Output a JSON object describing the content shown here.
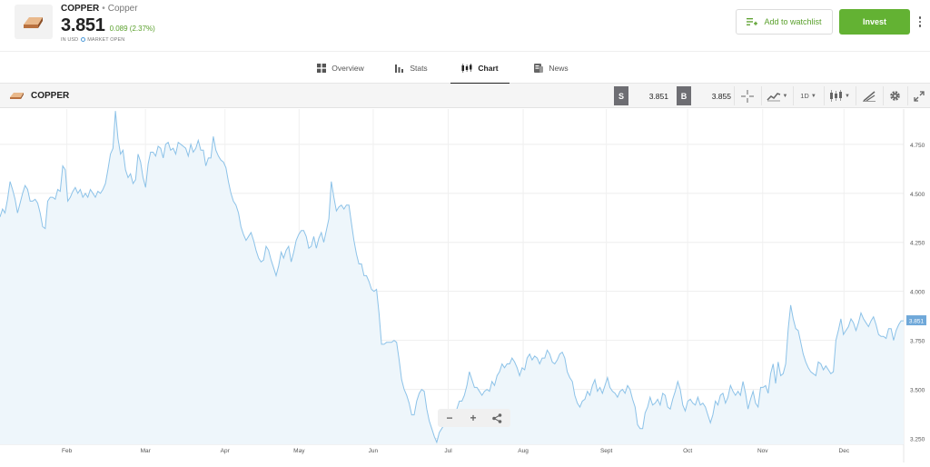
{
  "header": {
    "symbol": "COPPER",
    "separator": "•",
    "name": "Copper",
    "price": "3.851",
    "change": "0.089 (2.37%)",
    "currency_note": "IN USD",
    "market_status": "MARKET OPEN",
    "watchlist_label": "Add to watchlist",
    "invest_label": "Invest",
    "icons": {
      "logo": "copper-bar-icon",
      "watchlist": "add-to-list-icon",
      "more": "more-vertical-icon"
    }
  },
  "tabs": [
    {
      "label": "Overview",
      "icon": "grid-icon",
      "active": false
    },
    {
      "label": "Stats",
      "icon": "bar-chart-icon",
      "active": false
    },
    {
      "label": "Chart",
      "icon": "candles-icon",
      "active": true
    },
    {
      "label": "News",
      "icon": "news-icon",
      "active": false
    }
  ],
  "toolbar": {
    "symbol": "COPPER",
    "sell_label": "S",
    "sell_price": "3.851",
    "buy_label": "B",
    "buy_price": "3.855",
    "interval": "1D",
    "tools": [
      "crosshair-icon",
      "chart-type-icon",
      "interval-selector",
      "indicators-icon",
      "drawing-icon",
      "settings-icon",
      "fullscreen-icon"
    ]
  },
  "colors": {
    "accent_green": "#63b233",
    "change_green": "#5aa02c",
    "line_blue": "#8cc2e8",
    "area_fill": "#eef6fb",
    "badge_blue": "#6fa8d9"
  },
  "chart_data": {
    "type": "area",
    "x_labels": [
      "Feb",
      "Mar",
      "Apr",
      "May",
      "Jun",
      "Jul",
      "Aug",
      "Sept",
      "Oct",
      "Nov",
      "Dec"
    ],
    "y_ticks": [
      "4.750",
      "4.500",
      "4.250",
      "4.000",
      "3.750",
      "3.500",
      "3.250"
    ],
    "ylim": [
      3.22,
      4.93
    ],
    "last_value_label": "3.851",
    "grid": true,
    "values": [
      4.38,
      4.42,
      4.4,
      4.47,
      4.56,
      4.52,
      4.47,
      4.4,
      4.45,
      4.5,
      4.54,
      4.52,
      4.46,
      4.46,
      4.47,
      4.45,
      4.4,
      4.33,
      4.32,
      4.46,
      4.48,
      4.48,
      4.47,
      4.52,
      4.51,
      4.64,
      4.62,
      4.46,
      4.48,
      4.51,
      4.53,
      4.5,
      4.52,
      4.48,
      4.5,
      4.48,
      4.52,
      4.5,
      4.48,
      4.51,
      4.5,
      4.52,
      4.55,
      4.62,
      4.7,
      4.73,
      4.92,
      4.78,
      4.7,
      4.72,
      4.62,
      4.58,
      4.6,
      4.55,
      4.57,
      4.7,
      4.66,
      4.58,
      4.53,
      4.65,
      4.71,
      4.71,
      4.69,
      4.74,
      4.73,
      4.68,
      4.75,
      4.76,
      4.72,
      4.73,
      4.7,
      4.76,
      4.75,
      4.74,
      4.73,
      4.69,
      4.75,
      4.71,
      4.73,
      4.77,
      4.72,
      4.72,
      4.64,
      4.68,
      4.68,
      4.79,
      4.72,
      4.69,
      4.67,
      4.66,
      4.63,
      4.56,
      4.5,
      4.46,
      4.44,
      4.4,
      4.33,
      4.29,
      4.26,
      4.28,
      4.3,
      4.26,
      4.21,
      4.17,
      4.15,
      4.16,
      4.23,
      4.21,
      4.16,
      4.12,
      4.08,
      4.13,
      4.2,
      4.17,
      4.21,
      4.23,
      4.15,
      4.2,
      4.26,
      4.29,
      4.31,
      4.31,
      4.28,
      4.22,
      4.23,
      4.28,
      4.22,
      4.27,
      4.3,
      4.25,
      4.31,
      4.37,
      4.56,
      4.48,
      4.41,
      4.43,
      4.44,
      4.42,
      4.44,
      4.44,
      4.35,
      4.26,
      4.19,
      4.14,
      4.14,
      4.08,
      4.08,
      4.05,
      4.01,
      4.0,
      4.01,
      3.89,
      3.73,
      3.73,
      3.74,
      3.74,
      3.74,
      3.75,
      3.74,
      3.65,
      3.55,
      3.5,
      3.47,
      3.43,
      3.37,
      3.37,
      3.44,
      3.48,
      3.5,
      3.49,
      3.4,
      3.34,
      3.3,
      3.26,
      3.23,
      3.28,
      3.3,
      3.32,
      3.32,
      3.33,
      3.33,
      3.36,
      3.4,
      3.44,
      3.44,
      3.47,
      3.52,
      3.59,
      3.55,
      3.51,
      3.51,
      3.49,
      3.47,
      3.49,
      3.5,
      3.49,
      3.54,
      3.52,
      3.57,
      3.59,
      3.63,
      3.61,
      3.63,
      3.63,
      3.66,
      3.64,
      3.61,
      3.57,
      3.61,
      3.6,
      3.66,
      3.68,
      3.65,
      3.67,
      3.66,
      3.63,
      3.66,
      3.66,
      3.7,
      3.68,
      3.64,
      3.63,
      3.65,
      3.68,
      3.69,
      3.66,
      3.59,
      3.56,
      3.54,
      3.47,
      3.43,
      3.41,
      3.44,
      3.45,
      3.49,
      3.47,
      3.52,
      3.55,
      3.49,
      3.51,
      3.48,
      3.52,
      3.56,
      3.51,
      3.49,
      3.48,
      3.46,
      3.49,
      3.5,
      3.48,
      3.52,
      3.5,
      3.45,
      3.41,
      3.32,
      3.3,
      3.3,
      3.38,
      3.41,
      3.46,
      3.42,
      3.43,
      3.45,
      3.42,
      3.48,
      3.47,
      3.41,
      3.4,
      3.45,
      3.49,
      3.54,
      3.5,
      3.42,
      3.39,
      3.44,
      3.45,
      3.43,
      3.42,
      3.46,
      3.42,
      3.43,
      3.41,
      3.37,
      3.33,
      3.37,
      3.44,
      3.42,
      3.47,
      3.48,
      3.43,
      3.46,
      3.52,
      3.49,
      3.47,
      3.49,
      3.47,
      3.54,
      3.48,
      3.4,
      3.45,
      3.49,
      3.43,
      3.41,
      3.51,
      3.51,
      3.52,
      3.48,
      3.58,
      3.63,
      3.53,
      3.64,
      3.57,
      3.58,
      3.63,
      3.81,
      3.93,
      3.86,
      3.81,
      3.8,
      3.74,
      3.68,
      3.64,
      3.61,
      3.59,
      3.58,
      3.57,
      3.64,
      3.63,
      3.6,
      3.62,
      3.6,
      3.58,
      3.59,
      3.75,
      3.8,
      3.86,
      3.78,
      3.8,
      3.82,
      3.86,
      3.84,
      3.8,
      3.84,
      3.89,
      3.86,
      3.84,
      3.82,
      3.85,
      3.87,
      3.83,
      3.78,
      3.77,
      3.77,
      3.76,
      3.81,
      3.81,
      3.75,
      3.8,
      3.83,
      3.85,
      3.85
    ]
  }
}
